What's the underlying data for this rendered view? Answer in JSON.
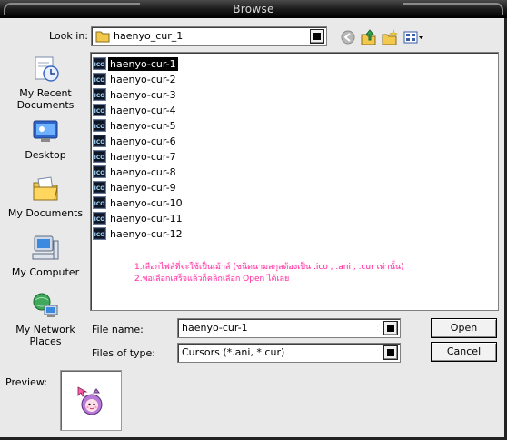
{
  "window": {
    "title": "Browse"
  },
  "lookin": {
    "label": "Look in:",
    "value": "haenyo_cur_1"
  },
  "toolbar": {
    "back": "back-icon",
    "up": "up-folder-icon",
    "new_folder": "new-folder-icon",
    "views": "views-menu-icon"
  },
  "places": [
    {
      "label": "My Recent Documents",
      "icon": "recent-documents-icon"
    },
    {
      "label": "Desktop",
      "icon": "desktop-icon"
    },
    {
      "label": "My Documents",
      "icon": "my-documents-icon"
    },
    {
      "label": "My Computer",
      "icon": "my-computer-icon"
    },
    {
      "label": "My Network Places",
      "icon": "network-places-icon"
    }
  ],
  "files": [
    {
      "name": "haenyo-cur-1",
      "selected": true
    },
    {
      "name": "haenyo-cur-2"
    },
    {
      "name": "haenyo-cur-3"
    },
    {
      "name": "haenyo-cur-4"
    },
    {
      "name": "haenyo-cur-5"
    },
    {
      "name": "haenyo-cur-6"
    },
    {
      "name": "haenyo-cur-7"
    },
    {
      "name": "haenyo-cur-8"
    },
    {
      "name": "haenyo-cur-9"
    },
    {
      "name": "haenyo-cur-10"
    },
    {
      "name": "haenyo-cur-11"
    },
    {
      "name": "haenyo-cur-12"
    }
  ],
  "file_icon_label": "ICO",
  "note": {
    "line1": "1.เลือกไฟล์ที่จะใช้เป็นเม้าส์ (ชนิดนามสกุลต้องเป็น .ico , .ani , .cur เท่านั้น)",
    "line2": "2.พอเลือกเสร็จแล้วก็คลิกเลือก Open ได้เลย"
  },
  "filename": {
    "label": "File name:",
    "value": "haenyo-cur-1"
  },
  "filetype": {
    "label": "Files of type:",
    "value": "Cursors (*.ani, *.cur)"
  },
  "buttons": {
    "open": "Open",
    "cancel": "Cancel"
  },
  "preview": {
    "label": "Preview:",
    "icon": "cursor-preview-icon"
  }
}
